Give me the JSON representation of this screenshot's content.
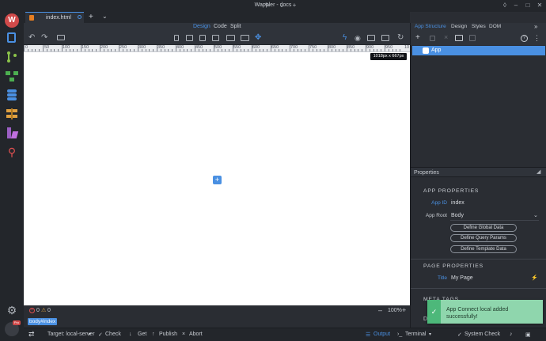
{
  "window": {
    "title": "Wappler - docs"
  },
  "tabs": [
    {
      "label": "index.html"
    }
  ],
  "modes": {
    "design": "Design",
    "code": "Code",
    "split": "Split",
    "active": "Design"
  },
  "ruler": {
    "labels": [
      "0",
      "50",
      "100",
      "150",
      "200",
      "250",
      "300",
      "350",
      "400",
      "450",
      "500",
      "550",
      "600",
      "650",
      "700",
      "750",
      "800",
      "850",
      "900",
      "950",
      "10"
    ]
  },
  "canvas": {
    "dimensions": "1018px x 667px",
    "add_symbol": "+"
  },
  "canvas_status": {
    "errors": "0",
    "warnings": "0",
    "zoom": "100%"
  },
  "breadcrumb": "body#index",
  "bottom": {
    "target": "Target: local-server",
    "check": "Check",
    "get": "Get",
    "publish": "Publish",
    "abort": "Abort",
    "output": "Output",
    "terminal": "Terminal",
    "system_check": "System Check"
  },
  "right_tabs": {
    "app_structure": "App Structure",
    "design": "Design",
    "styles": "Styles",
    "dom": "DOM"
  },
  "tree": {
    "app": "App"
  },
  "properties": {
    "header": "Properties",
    "app_section": "APP PROPERTIES",
    "app_id_label": "App ID",
    "app_id_value": "index",
    "app_root_label": "App Root",
    "app_root_value": "Body",
    "btn_global": "Define Global Data",
    "btn_query": "Define Query Params",
    "btn_template": "Define Template Data",
    "page_section": "PAGE PROPERTIES",
    "title_label": "Title",
    "title_value": "My Page",
    "meta_section": "META TAGS"
  },
  "toast": {
    "message": "App Connect local added successfully!"
  },
  "colors": {
    "accent": "#4a90e2",
    "success": "#4db87a",
    "toast_bg": "#8fd6ad"
  }
}
